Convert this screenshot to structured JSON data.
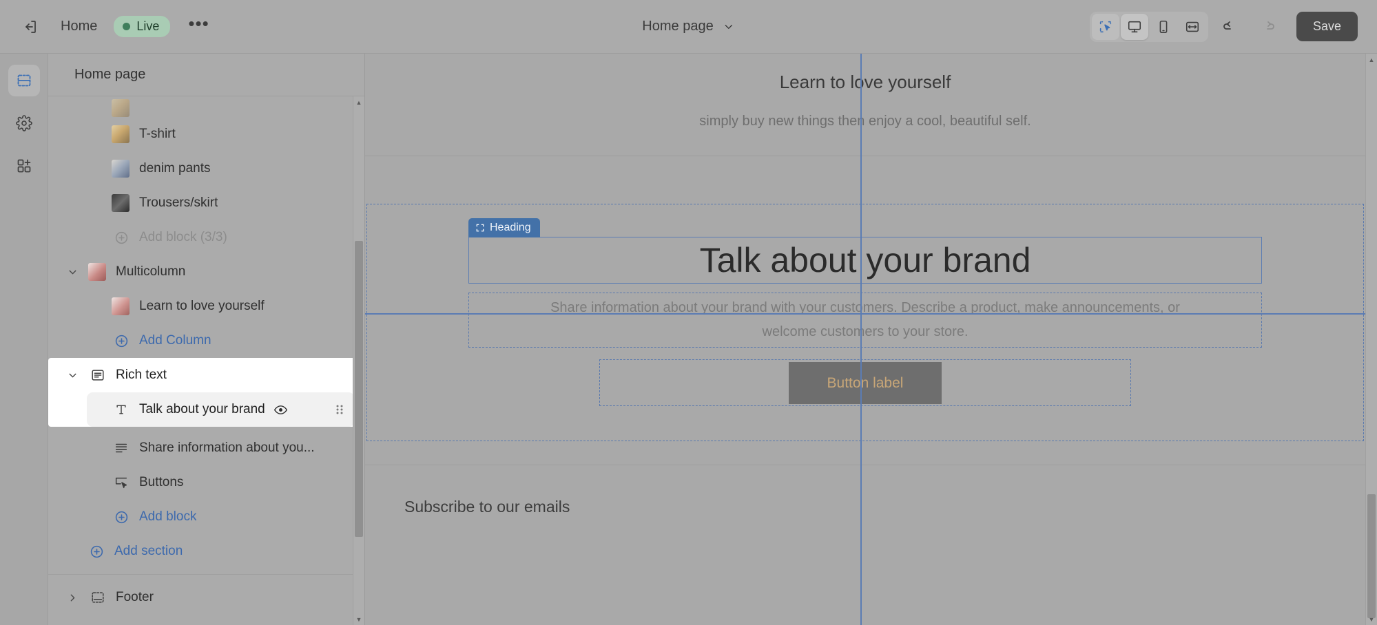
{
  "topbar": {
    "exit_icon": "exit-icon",
    "home_label": "Home",
    "live_label": "Live",
    "live_color": "#3f7f5c",
    "more_label": "•••",
    "page_selector_label": "Home page",
    "chevron_icon": "chevron-down-icon",
    "tools": [
      {
        "name": "inspector-tool",
        "icon": "select-cursor-icon",
        "active": true
      },
      {
        "name": "desktop-view",
        "icon": "desktop-icon",
        "active": true
      },
      {
        "name": "mobile-view",
        "icon": "mobile-icon",
        "active": false
      },
      {
        "name": "fullwidth-view",
        "icon": "fullwidth-icon",
        "active": false
      }
    ],
    "undo_icon": "undo-icon",
    "redo_icon": "redo-icon",
    "save_label": "Save",
    "save_bg": "#4a4a4a"
  },
  "rail": {
    "items": [
      {
        "name": "sections-rail-item",
        "icon": "sections-icon",
        "active": true
      },
      {
        "name": "settings-rail-item",
        "icon": "gear-icon",
        "active": false
      },
      {
        "name": "apps-rail-item",
        "icon": "apps-add-icon",
        "active": false
      }
    ]
  },
  "tree": {
    "title": "Home page",
    "rows": [
      {
        "label": "T-shirt",
        "kind": "thumb",
        "thumb": "tshirt",
        "indent": 2
      },
      {
        "label": "denim pants",
        "kind": "thumb",
        "thumb": "denim",
        "indent": 2
      },
      {
        "label": "Trousers/skirt",
        "kind": "thumb",
        "thumb": "trouser",
        "indent": 2
      },
      {
        "label": "Add block (3/3)",
        "kind": "add-muted",
        "indent": 2
      },
      {
        "label": "Multicolumn",
        "kind": "thumb-caret",
        "thumb": "multicol",
        "indent": 0
      },
      {
        "label": "Learn to love yourself",
        "kind": "thumb",
        "thumb": "learn",
        "indent": 2
      },
      {
        "label": "Add Column",
        "kind": "add-link",
        "indent": 2
      }
    ],
    "selected_group": {
      "label": "Rich text",
      "icon": "rich-text-icon",
      "caret": "chevron-down-icon",
      "child": {
        "label": "Talk about your brand",
        "icon": "text-t-icon",
        "eye_icon": "eye-icon",
        "drag_icon": "drag-handle-icon"
      }
    },
    "rows_after": [
      {
        "label": "Share information about you...",
        "kind": "glyph",
        "glyph": "paragraph-icon",
        "indent": 2
      },
      {
        "label": "Buttons",
        "kind": "glyph",
        "glyph": "button-icon",
        "indent": 2
      },
      {
        "label": "Add block",
        "kind": "add-link",
        "indent": 2
      },
      {
        "label": "Add section",
        "kind": "add-link",
        "indent": 1
      }
    ],
    "footer_row": {
      "label": "Footer",
      "caret": "chevron-right-icon",
      "icon": "footer-icon"
    }
  },
  "canvas": {
    "top_heading": "Learn to love yourself",
    "top_subtext": "simply buy new things then enjoy a cool, beautiful self.",
    "block_tag": "Heading",
    "block_tag_icon": "resize-brackets-icon",
    "heading_text": "Talk about your brand",
    "paragraph_line1": "Share information about your brand with your customers. Describe a product, make announcements, or",
    "paragraph_line2": "welcome customers to your store.",
    "button_label": "Button label",
    "button_bg": "#6e6e6e",
    "button_fg": "#c8a677",
    "subscribe_heading": "Subscribe to our emails",
    "guide_color": "#5b7cb3",
    "selection_color": "#4371a8"
  }
}
